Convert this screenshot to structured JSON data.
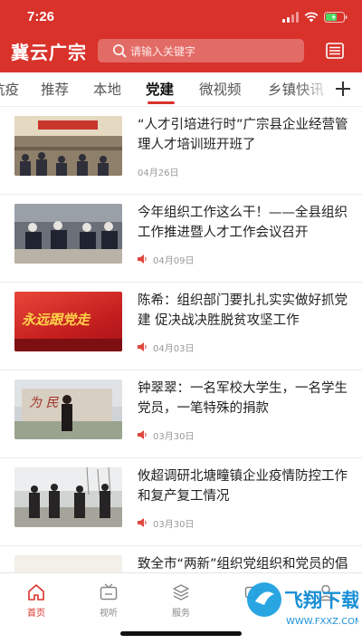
{
  "status_bar": {
    "time": "7:26"
  },
  "app": {
    "logo_text": "冀云广宗"
  },
  "search": {
    "placeholder": "请输入关键字"
  },
  "tabs": [
    {
      "label": "抗疫"
    },
    {
      "label": "推荐"
    },
    {
      "label": "本地"
    },
    {
      "label": "党建",
      "active": true
    },
    {
      "label": "微视频"
    },
    {
      "label": "乡镇快讯"
    }
  ],
  "articles": [
    {
      "title": "“人才引培进行时”广宗县企业经营管理人才培训班开班了",
      "date": "04月26日",
      "has_audio": false
    },
    {
      "title": "今年组织工作这么干！——全县组织工作推进暨人才工作会议召开",
      "date": "04月09日",
      "has_audio": true
    },
    {
      "title": "陈希：组织部门要扎扎实实做好抓党建 促决战决胜脱贫攻坚工作",
      "date": "04月03日",
      "has_audio": true,
      "thumb_text": "永远跟党走"
    },
    {
      "title": "钟翠翠：一名军校大学生，一名学生党员，一笔特殊的捐款",
      "date": "03月30日",
      "has_audio": true
    },
    {
      "title": "攸超调研北塘疃镇企业疫情防控工作和复产复工情况",
      "date": "03月30日",
      "has_audio": true
    },
    {
      "title": "致全市“两新”组织党组织和党员的倡议书",
      "date": "",
      "has_audio": false
    }
  ],
  "bottom_nav": [
    {
      "label": "首页",
      "icon": "home-icon",
      "active": true
    },
    {
      "label": "视听",
      "icon": "tv-icon"
    },
    {
      "label": "服务",
      "icon": "service-icon"
    },
    {
      "label": "",
      "icon": "video-icon"
    },
    {
      "label": "",
      "icon": "user-icon"
    }
  ],
  "watermark": {
    "text": "飞翔下载",
    "url_text": "WWW.FXXZ.COM"
  },
  "colors": {
    "brand": "#d8322b",
    "text": "#222222",
    "muted": "#999999"
  }
}
